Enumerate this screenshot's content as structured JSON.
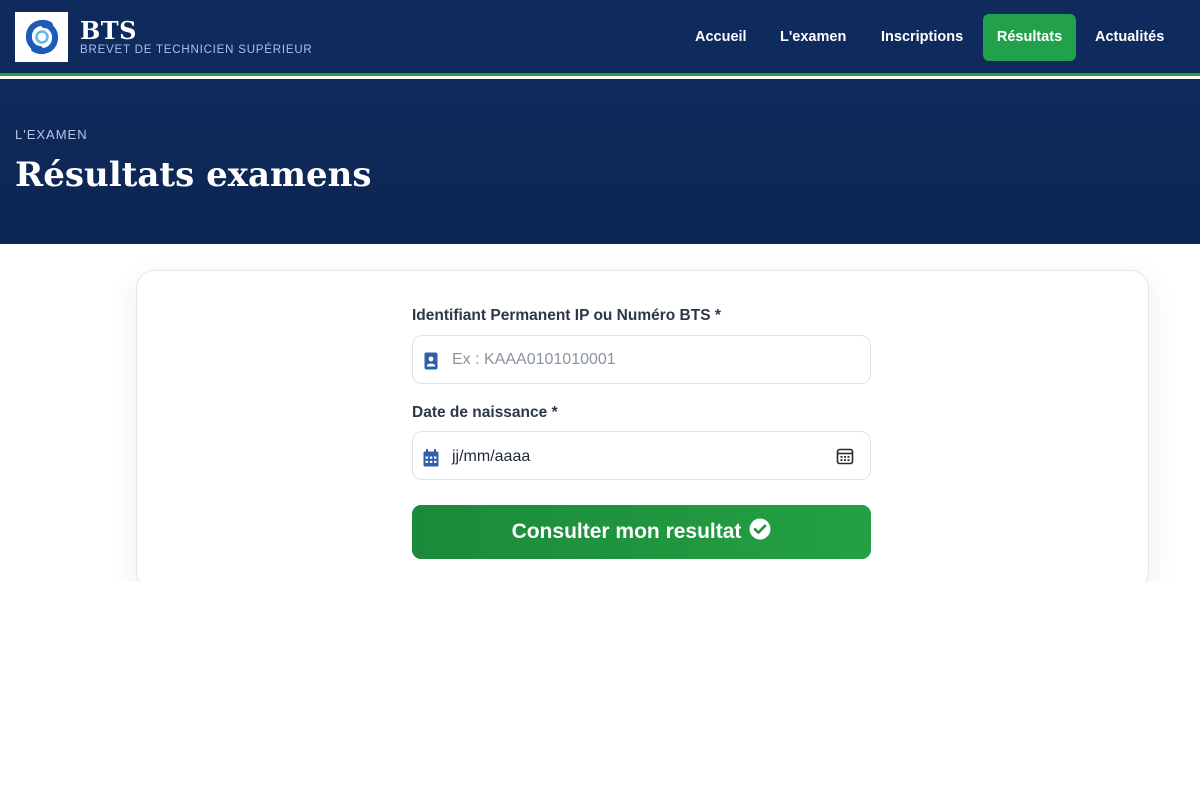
{
  "brand": {
    "title": "BTS",
    "subtitle": "BREVET DE TECHNICIEN SUPÉRIEUR",
    "logo_icon": "bts-logo-icon"
  },
  "nav": {
    "items": [
      {
        "label": "Accueil",
        "active": false
      },
      {
        "label": "L'examen",
        "active": false
      },
      {
        "label": "Inscriptions",
        "active": false
      },
      {
        "label": "Résultats",
        "active": true
      },
      {
        "label": "Actualités",
        "active": false
      }
    ]
  },
  "hero": {
    "eyebrow": "L'EXAMEN",
    "title": "Résultats examens"
  },
  "form": {
    "id_label": "Identifiant Permanent IP ou Numéro BTS *",
    "id_placeholder": "Ex : KAAA0101010001",
    "id_value": "",
    "id_icon": "id-card-icon",
    "dob_label": "Date de naissance *",
    "dob_value": "jj/mm/aaaa",
    "dob_icon": "calendar-icon",
    "dob_picker_icon": "calendar-picker-icon",
    "submit_label": "Consulter mon resultat",
    "submit_icon": "check-circle-icon"
  },
  "colors": {
    "navy": "#0f2a5c",
    "accent_green": "#22a04a",
    "icon_blue": "#2f5fae"
  }
}
